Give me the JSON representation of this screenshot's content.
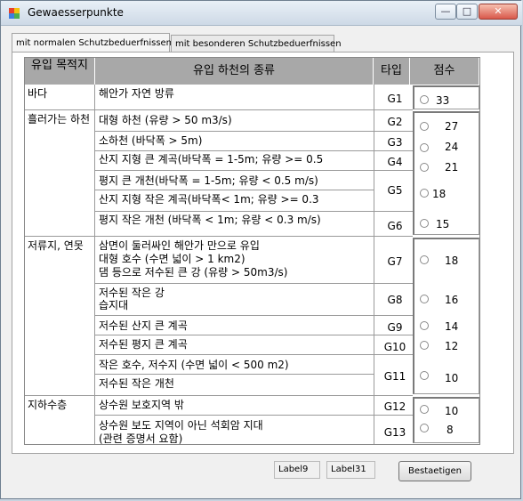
{
  "window": {
    "title": "Gewaesserpunkte"
  },
  "tabs": [
    {
      "label": "mit normalen Schutzbeduerfnissen"
    },
    {
      "label": "mit besonderen Schutzbeduerfnissen"
    }
  ],
  "table": {
    "headers": [
      "유입 목적지",
      "유입 하천의 종류",
      "타입",
      "점수"
    ],
    "categories": [
      {
        "label": "바다"
      },
      {
        "label": "흘러가는 하천"
      },
      {
        "label": "저류지, 연못"
      },
      {
        "label": "지하수층"
      }
    ],
    "rows": [
      {
        "desc": "해안가 자연 방류",
        "code": "G1"
      },
      {
        "desc": "대형 하천 (유량 > 50 m3/s)",
        "code": "G2"
      },
      {
        "desc": "소하천 (바닥폭 > 5m)",
        "code": "G3"
      },
      {
        "desc": "산지 지형 큰 계곡(바닥폭 = 1-5m; 유량 >= 0.5",
        "code": "G4"
      },
      {
        "desc": "평지 큰 개천(바닥폭 = 1-5m; 유량 < 0.5 m/s)",
        "code": ""
      },
      {
        "desc": "산지 지형 작은 계곡(바닥폭< 1m; 유량 >= 0.3",
        "code": "G5"
      },
      {
        "desc": "평지 작은 개천 (바닥폭 < 1m; 유량 < 0.3 m/s)",
        "code": "G6"
      },
      {
        "desc": "삼면이 둘러싸인 해안가 만으로 유입",
        "desc2": "대형 호수     (수면 넓이 > 1 km2)",
        "desc3": "댐 등으로 저수된 큰 강     (유량 > 50m3/s)",
        "code": "G7"
      },
      {
        "desc": "저수된 작은 강",
        "desc2": "습지대",
        "code": "G8"
      },
      {
        "desc": "저수된 산지 큰 계곡",
        "code": "G9"
      },
      {
        "desc": "저수된 평지 큰 계곡",
        "code": "G10"
      },
      {
        "desc": "작은 호수, 저수지  (수면 넓이 < 500 m2)",
        "code": ""
      },
      {
        "desc": "저수된 작은 개천",
        "code": "G11"
      },
      {
        "desc": "상수원 보호지역 밖",
        "code": "G12"
      },
      {
        "desc": "상수원 보도 지역이 아닌 석회암 지대",
        "desc2": " (관련 증명서 요함)",
        "code": "G13"
      }
    ],
    "scores": [
      "33",
      "27",
      "24",
      "21",
      "18",
      "15",
      "18",
      "16",
      "14",
      "12",
      "10",
      "10",
      "8"
    ]
  },
  "footer": {
    "label1": "Label9",
    "label2": "Label31",
    "confirm_button": "Bestaetigen"
  },
  "colors": {
    "header_bg": "#a8a8a8",
    "title_gradient": "#cdd9e6"
  }
}
